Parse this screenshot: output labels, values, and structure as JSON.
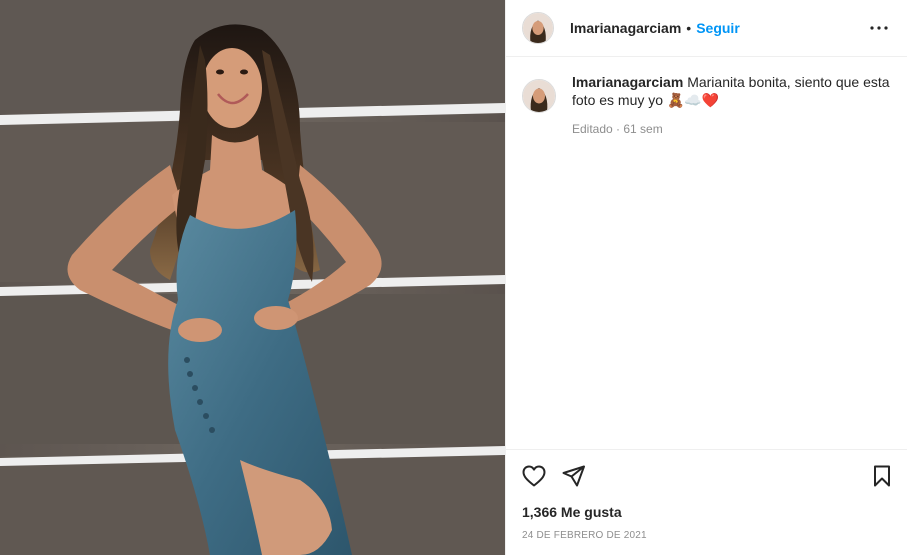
{
  "post": {
    "username": "lmarianagarciam",
    "follow_label": "Seguir",
    "separator": "•",
    "caption_text": "Marianita bonita, siento que esta foto es muy yo",
    "caption_emojis": "🧸☁️❤️",
    "caption_meta": "Editado · 61 sem",
    "likes": "1,366 Me gusta",
    "date": "24 DE FEBRERO DE 2021"
  },
  "icons": {
    "more": "more-options-icon",
    "like": "heart-icon",
    "share": "share-icon",
    "save": "bookmark-icon"
  },
  "colors": {
    "follow": "#0095f6",
    "muted": "#8e8e8e",
    "text": "#262626",
    "divider": "#efefef",
    "dress": "#3f6f86"
  }
}
